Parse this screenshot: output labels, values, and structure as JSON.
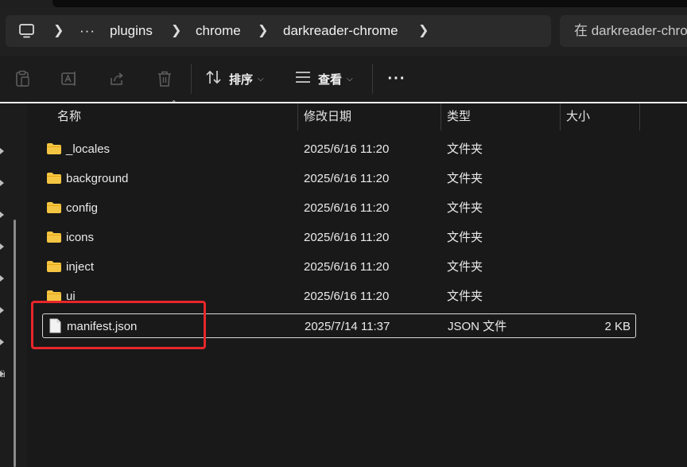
{
  "breadcrumb": {
    "items": [
      "plugins",
      "chrome",
      "darkreader-chrome"
    ],
    "more": "···"
  },
  "search": {
    "placeholder": "在 darkreader-chrome 中搜索"
  },
  "toolbar": {
    "sort_label": "排序",
    "view_label": "查看",
    "more_label": "···"
  },
  "columns": {
    "name": "名称",
    "modified": "修改日期",
    "type": "类型",
    "size": "大小"
  },
  "files": [
    {
      "name": "_locales",
      "modified": "2025/6/16 11:20",
      "type": "文件夹",
      "size": "",
      "kind": "folder"
    },
    {
      "name": "background",
      "modified": "2025/6/16 11:20",
      "type": "文件夹",
      "size": "",
      "kind": "folder"
    },
    {
      "name": "config",
      "modified": "2025/6/16 11:20",
      "type": "文件夹",
      "size": "",
      "kind": "folder"
    },
    {
      "name": "icons",
      "modified": "2025/6/16 11:20",
      "type": "文件夹",
      "size": "",
      "kind": "folder"
    },
    {
      "name": "inject",
      "modified": "2025/6/16 11:20",
      "type": "文件夹",
      "size": "",
      "kind": "folder"
    },
    {
      "name": "ui",
      "modified": "2025/6/16 11:20",
      "type": "文件夹",
      "size": "",
      "kind": "folder"
    },
    {
      "name": "manifest.json",
      "modified": "2025/7/14 11:37",
      "type": "JSON 文件",
      "size": "2 KB",
      "kind": "file",
      "selected": true
    }
  ],
  "leftpane_fragment": "ü",
  "colors": {
    "highlight": "#e8262b",
    "folder": "#f4c542"
  }
}
